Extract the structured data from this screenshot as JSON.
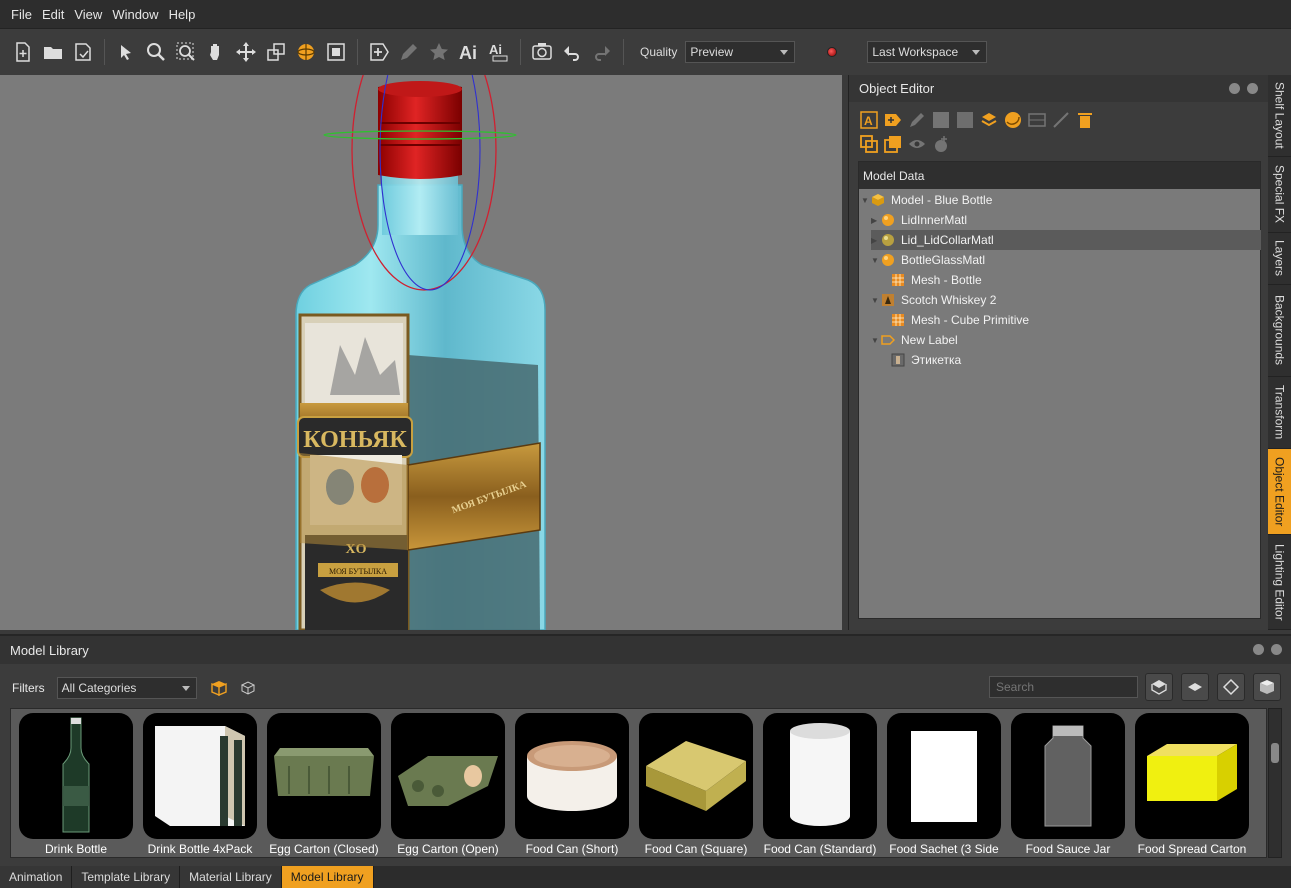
{
  "menu": [
    "File",
    "Edit",
    "View",
    "Window",
    "Help"
  ],
  "toolbar": {
    "quality_label": "Quality",
    "quality_value": "Preview",
    "workspace_value": "Last Workspace"
  },
  "object_editor": {
    "title": "Object Editor",
    "model_data_header": "Model Data",
    "tree": [
      {
        "label": "Model - Blue Bottle",
        "icon": "model-icon",
        "level": 0,
        "expanded": true
      },
      {
        "label": "LidInnerMatl",
        "icon": "material-icon",
        "level": 1,
        "expanded": false
      },
      {
        "label": "Lid_LidCollarMatl",
        "icon": "material-icon",
        "level": 1,
        "expanded": false,
        "selected": true
      },
      {
        "label": "BottleGlassMatl",
        "icon": "material-icon",
        "level": 1,
        "expanded": true
      },
      {
        "label": "Mesh - Bottle",
        "icon": "mesh-icon",
        "level": 2
      },
      {
        "label": "Scotch Whiskey 2",
        "icon": "texture-icon",
        "level": 1,
        "expanded": true
      },
      {
        "label": "Mesh - Cube Primitive",
        "icon": "mesh-icon",
        "level": 2
      },
      {
        "label": "New Label",
        "icon": "label-icon",
        "level": 1,
        "expanded": true
      },
      {
        "label": "Этикетка",
        "icon": "label-texture-icon",
        "level": 2
      }
    ]
  },
  "side_tabs": [
    "Shelf Layout",
    "Special FX",
    "Layers",
    "Backgrounds",
    "Transform",
    "Object Editor",
    "Lighting Editor"
  ],
  "side_tabs_active": "Object Editor",
  "model_library": {
    "title": "Model Library",
    "filters_label": "Filters",
    "category_value": "All Categories",
    "search_placeholder": "Search",
    "items": [
      "Drink Bottle",
      "Drink Bottle 4xPack",
      "Egg Carton (Closed)",
      "Egg Carton (Open)",
      "Food Can (Short)",
      "Food Can (Square)",
      "Food Can (Standard)",
      "Food Sachet (3 Side",
      "Food Sauce Jar",
      "Food Spread Carton"
    ]
  },
  "bottom_tabs": [
    "Animation",
    "Template Library",
    "Material Library",
    "Model Library"
  ],
  "bottom_tabs_active": "Model Library",
  "viewport": {
    "label_brand": "КОНЬЯК",
    "label_sub": "XO",
    "label_band": "МОЯ БУТЫЛКА",
    "label_bottom": "МОЯ БУТЫЛКА"
  },
  "colors": {
    "accent": "#f0a020",
    "panel": "#3c3c3c",
    "viewport": "#7b7b7b"
  }
}
